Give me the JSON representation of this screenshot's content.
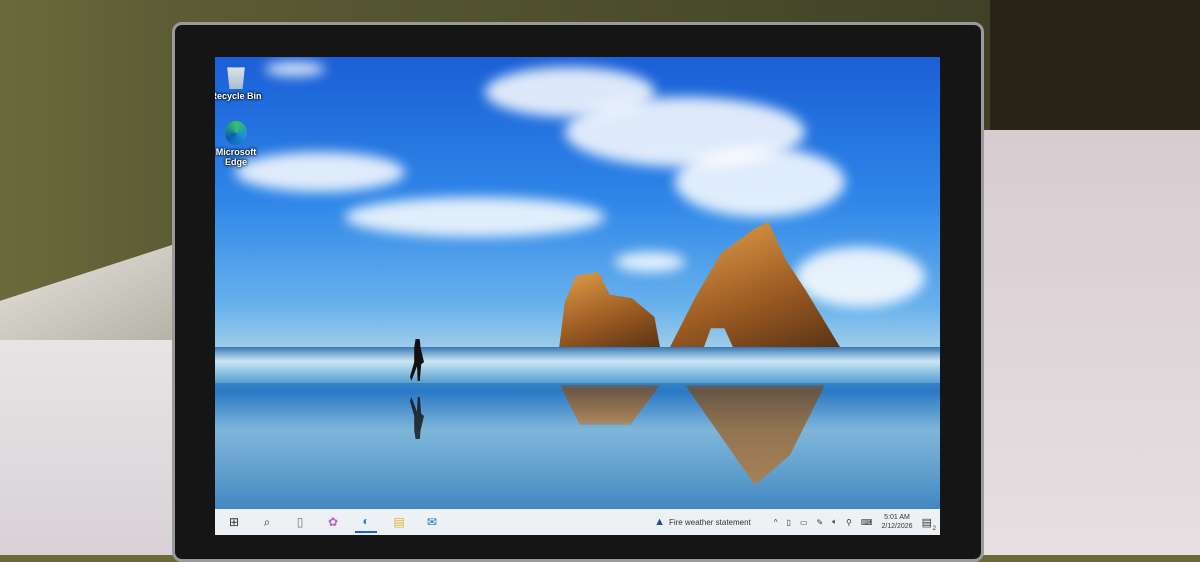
{
  "desktop": {
    "icons": [
      {
        "label": "Recycle Bin",
        "icon": "recycle-bin-icon"
      },
      {
        "label": "Microsoft Edge",
        "icon": "edge-icon"
      }
    ]
  },
  "taskbar": {
    "apps": [
      {
        "name": "start",
        "glyph": "⊞"
      },
      {
        "name": "search",
        "glyph": "⌕"
      },
      {
        "name": "task-view",
        "glyph": "▯"
      },
      {
        "name": "copilot",
        "glyph": "✿"
      },
      {
        "name": "edge",
        "glyph": "◐"
      },
      {
        "name": "file-explorer",
        "glyph": "▤"
      },
      {
        "name": "outlook",
        "glyph": "✉"
      }
    ],
    "weather": "Fire weather statement",
    "time": "5:01 AM",
    "date": "2/12/2026",
    "notification_count": "2",
    "colors": {
      "taskbar": "#eef1f4",
      "accent": "#1a5fd6"
    }
  }
}
